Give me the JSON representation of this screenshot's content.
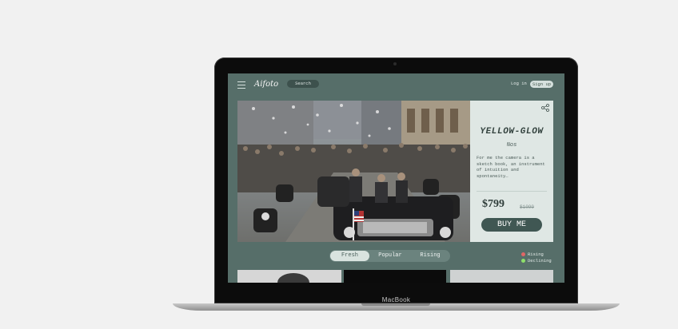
{
  "device": {
    "brand_label": "MacBook"
  },
  "nav": {
    "logo": "Aifoto",
    "search_label": "Search",
    "login_label": "Log in",
    "signup_label": "Sign up"
  },
  "product": {
    "title": "YELLOW-GLOW",
    "subtitle": "Nos",
    "description": "For me the camera is a sketch book, an instrument of intuition and spontaneity…",
    "price": "$799",
    "old_price": "$1099",
    "buy_label": "BUY ME"
  },
  "tabs": [
    {
      "label": "Fresh",
      "active": true
    },
    {
      "label": "Popular",
      "active": false
    },
    {
      "label": "Rising",
      "active": false
    }
  ],
  "legend": [
    {
      "label": "Rising",
      "color": "#e06666"
    },
    {
      "label": "Declining",
      "color": "#8ee06a"
    }
  ],
  "colors": {
    "screen_bg": "#566e69",
    "card_bg": "#dfe7e4",
    "accent_button": "#405753"
  }
}
